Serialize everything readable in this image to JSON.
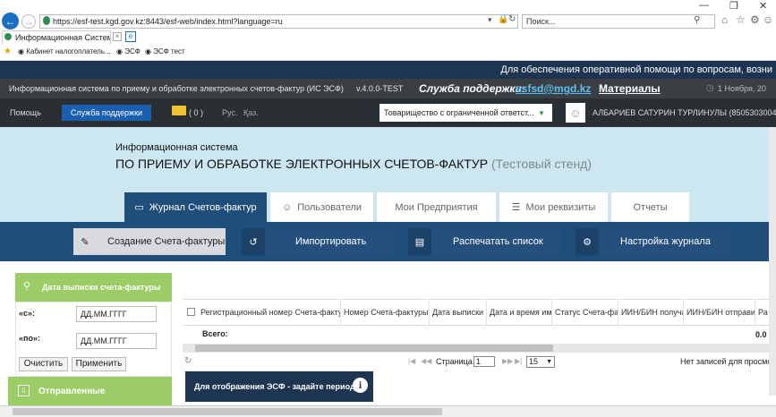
{
  "browser": {
    "url": "https://esf-test.kgd.gov.kz:8443/esf-web/index.html?language=ru",
    "search_placeholder": "Поиск...",
    "tab_title": "Информационная Система ...",
    "favorites": [
      "Кабинет налогоплатель...",
      "ЭСФ",
      "ЭСФ тест"
    ]
  },
  "site": {
    "announcement": "Для обеспечения оперативной помощи по вопросам, возни",
    "system_name": "Информационная система по приему и обработке электронных счетов-фактур (ИС ЭСФ)",
    "version": "v.4.0.0-TEST",
    "support_label": "Служба поддержки:",
    "support_email": "esfsd@mgd.kz",
    "materials": "Материалы",
    "date": "1 Ноября, 20",
    "help": "Помощь",
    "support_button": "Служба поддержки",
    "messages_count": "( 0 )",
    "lang_ru": "Рус.",
    "lang_kz": "Қаз.",
    "org_select": "Товарищество с ограниченной ответст...",
    "user_name": "АЛБАРИЕВ САТУРИН ТУРЛИНУЛЫ (85053030046"
  },
  "hero": {
    "line1": "Информационная система",
    "line2": "ПО ПРИЕМУ И ОБРАБОТКЕ ЭЛЕКТРОННЫХ СЧЕТОВ-ФАКТУР",
    "suffix": "(Тестовый стенд)"
  },
  "tabs": [
    {
      "label": "Журнал Счетов-фактур"
    },
    {
      "label": "Пользователи"
    },
    {
      "label": "Мои Предприятия"
    },
    {
      "label": "Мои реквизиты"
    },
    {
      "label": "Отчеты"
    }
  ],
  "actions": [
    {
      "label": "Создание Счета-фактуры"
    },
    {
      "label": "Импортировать"
    },
    {
      "label": "Распечатать список"
    },
    {
      "label": "Настройка журнала"
    }
  ],
  "filter": {
    "title": "Дата выписки счета-фактуры",
    "from_label": "«с»:",
    "to_label": "«по»:",
    "from_placeholder": "ДД.ММ.ГГГГ",
    "to_placeholder": "ДД.ММ.ГГГГ",
    "clear": "Очистить",
    "apply": "Применить"
  },
  "grid": {
    "columns": [
      "Регистрационный номер Счета-фактур",
      "Номер Счета-фактуры",
      "Дата выписки",
      "Дата и время имг",
      "Статус Счета-фак",
      "ИИН/БИН получа",
      "ИИН/БИН отправит",
      "Ра"
    ],
    "total_label": "Всего:",
    "total_value": "0.0",
    "page_label": "Страница",
    "page_value": "1",
    "page_size": "15",
    "no_records": "Нет записей для просмо"
  },
  "sidebar": {
    "sent": "Отправленные"
  },
  "hint": {
    "text": "Для отображения ЭСФ - задайте период"
  },
  "colors": {
    "accent_green": "#9ccc65",
    "nav_blue": "#1f4e7a",
    "dark_navy": "#1e3552",
    "hero_bg": "#cce7ef"
  }
}
